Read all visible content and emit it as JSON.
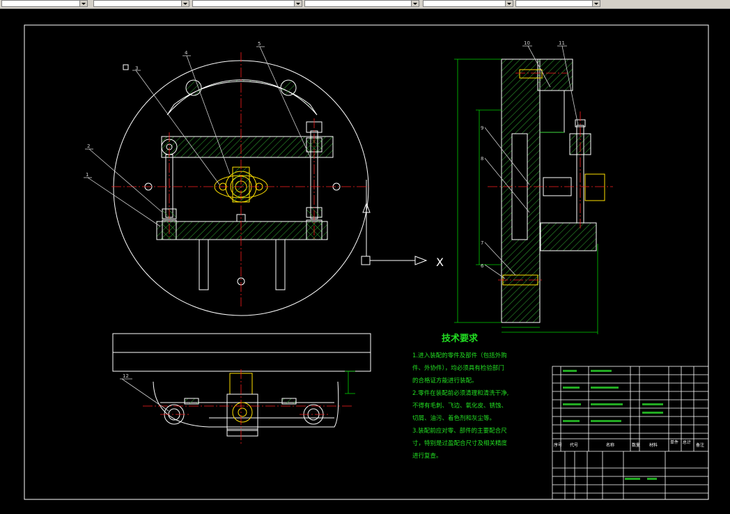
{
  "toolbar": {
    "cell1": "",
    "cell2": "",
    "cell3": "",
    "cell4": "",
    "cell5": "",
    "cell6": ""
  },
  "drawing": {
    "tech_title": "技术要求",
    "tech_lines": [
      "1.进入装配的零件及部件（包括外购",
      "件、外协件），均必须具有检验部门",
      "的合格证方能进行装配。",
      "2.零件在装配前必须清理和清洗干净,",
      "不得有毛刺、飞边、氧化皮、锈蚀、",
      "切屑、油污、着色剂和灰尘等。",
      "3.装配前应对零、部件的主要配合尺",
      "寸，特别是过盈配合尺寸及相关精度",
      "进行复查。"
    ],
    "balloons": [
      "1",
      "2",
      "3",
      "4",
      "5",
      "6",
      "7",
      "8",
      "9",
      "10",
      "11",
      "12"
    ],
    "view_label": "X",
    "title_block_headers": [
      "序号",
      "代号",
      "名称",
      "数量",
      "材料",
      "单件",
      "总计",
      "备注"
    ],
    "colors": {
      "outline": "#ffffff",
      "center": "#ff2020",
      "hatch": "#2fa12f",
      "yellow": "#ffe000",
      "dim": "#00d000",
      "tech": "#22dd22",
      "leader": "#cfcfcf"
    }
  }
}
